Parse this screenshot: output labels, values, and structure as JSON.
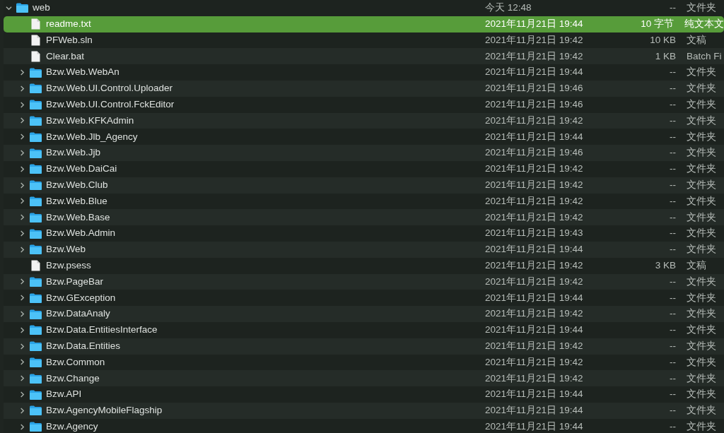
{
  "files": [
    {
      "kind": "folder",
      "name": "web",
      "date": "今天 12:48",
      "size": "--",
      "type": "文件夹",
      "selected": false,
      "expanded": true,
      "children": [
        {
          "kind": "file",
          "name": "readme.txt",
          "date": "2021年11月21日 19:44",
          "size": "10 字节",
          "type": "纯文本文",
          "selected": true
        },
        {
          "kind": "file",
          "name": "PFWeb.sln",
          "date": "2021年11月21日 19:42",
          "size": "10 KB",
          "type": "文稿",
          "selected": false
        },
        {
          "kind": "file",
          "name": "Clear.bat",
          "date": "2021年11月21日 19:42",
          "size": "1 KB",
          "type": "Batch Fi",
          "selected": false
        },
        {
          "kind": "folder",
          "name": "Bzw.Web.WebAn",
          "date": "2021年11月21日 19:44",
          "size": "--",
          "type": "文件夹",
          "selected": false,
          "expanded": false
        },
        {
          "kind": "folder",
          "name": "Bzw.Web.UI.Control.Uploader",
          "date": "2021年11月21日 19:46",
          "size": "--",
          "type": "文件夹",
          "selected": false,
          "expanded": false
        },
        {
          "kind": "folder",
          "name": "Bzw.Web.UI.Control.FckEditor",
          "date": "2021年11月21日 19:46",
          "size": "--",
          "type": "文件夹",
          "selected": false,
          "expanded": false
        },
        {
          "kind": "folder",
          "name": "Bzw.Web.KFKAdmin",
          "date": "2021年11月21日 19:42",
          "size": "--",
          "type": "文件夹",
          "selected": false,
          "expanded": false
        },
        {
          "kind": "folder",
          "name": "Bzw.Web.Jlb_Agency",
          "date": "2021年11月21日 19:44",
          "size": "--",
          "type": "文件夹",
          "selected": false,
          "expanded": false
        },
        {
          "kind": "folder",
          "name": "Bzw.Web.Jjb",
          "date": "2021年11月21日 19:46",
          "size": "--",
          "type": "文件夹",
          "selected": false,
          "expanded": false
        },
        {
          "kind": "folder",
          "name": "Bzw.Web.DaiCai",
          "date": "2021年11月21日 19:42",
          "size": "--",
          "type": "文件夹",
          "selected": false,
          "expanded": false
        },
        {
          "kind": "folder",
          "name": "Bzw.Web.Club",
          "date": "2021年11月21日 19:42",
          "size": "--",
          "type": "文件夹",
          "selected": false,
          "expanded": false
        },
        {
          "kind": "folder",
          "name": "Bzw.Web.Blue",
          "date": "2021年11月21日 19:42",
          "size": "--",
          "type": "文件夹",
          "selected": false,
          "expanded": false
        },
        {
          "kind": "folder",
          "name": "Bzw.Web.Base",
          "date": "2021年11月21日 19:42",
          "size": "--",
          "type": "文件夹",
          "selected": false,
          "expanded": false
        },
        {
          "kind": "folder",
          "name": "Bzw.Web.Admin",
          "date": "2021年11月21日 19:43",
          "size": "--",
          "type": "文件夹",
          "selected": false,
          "expanded": false
        },
        {
          "kind": "folder",
          "name": "Bzw.Web",
          "date": "2021年11月21日 19:44",
          "size": "--",
          "type": "文件夹",
          "selected": false,
          "expanded": false
        },
        {
          "kind": "file",
          "name": "Bzw.psess",
          "date": "2021年11月21日 19:42",
          "size": "3 KB",
          "type": "文稿",
          "selected": false
        },
        {
          "kind": "folder",
          "name": "Bzw.PageBar",
          "date": "2021年11月21日 19:42",
          "size": "--",
          "type": "文件夹",
          "selected": false,
          "expanded": false
        },
        {
          "kind": "folder",
          "name": "Bzw.GException",
          "date": "2021年11月21日 19:44",
          "size": "--",
          "type": "文件夹",
          "selected": false,
          "expanded": false
        },
        {
          "kind": "folder",
          "name": "Bzw.DataAnaly",
          "date": "2021年11月21日 19:42",
          "size": "--",
          "type": "文件夹",
          "selected": false,
          "expanded": false
        },
        {
          "kind": "folder",
          "name": "Bzw.Data.EntitiesInterface",
          "date": "2021年11月21日 19:44",
          "size": "--",
          "type": "文件夹",
          "selected": false,
          "expanded": false
        },
        {
          "kind": "folder",
          "name": "Bzw.Data.Entities",
          "date": "2021年11月21日 19:42",
          "size": "--",
          "type": "文件夹",
          "selected": false,
          "expanded": false
        },
        {
          "kind": "folder",
          "name": "Bzw.Common",
          "date": "2021年11月21日 19:42",
          "size": "--",
          "type": "文件夹",
          "selected": false,
          "expanded": false
        },
        {
          "kind": "folder",
          "name": "Bzw.Change",
          "date": "2021年11月21日 19:42",
          "size": "--",
          "type": "文件夹",
          "selected": false,
          "expanded": false
        },
        {
          "kind": "folder",
          "name": "Bzw.API",
          "date": "2021年11月21日 19:44",
          "size": "--",
          "type": "文件夹",
          "selected": false,
          "expanded": false
        },
        {
          "kind": "folder",
          "name": "Bzw.AgencyMobileFlagship",
          "date": "2021年11月21日 19:44",
          "size": "--",
          "type": "文件夹",
          "selected": false,
          "expanded": false
        },
        {
          "kind": "folder",
          "name": "Bzw.Agency",
          "date": "2021年11月21日 19:44",
          "size": "--",
          "type": "文件夹",
          "selected": false,
          "expanded": false
        }
      ]
    }
  ]
}
